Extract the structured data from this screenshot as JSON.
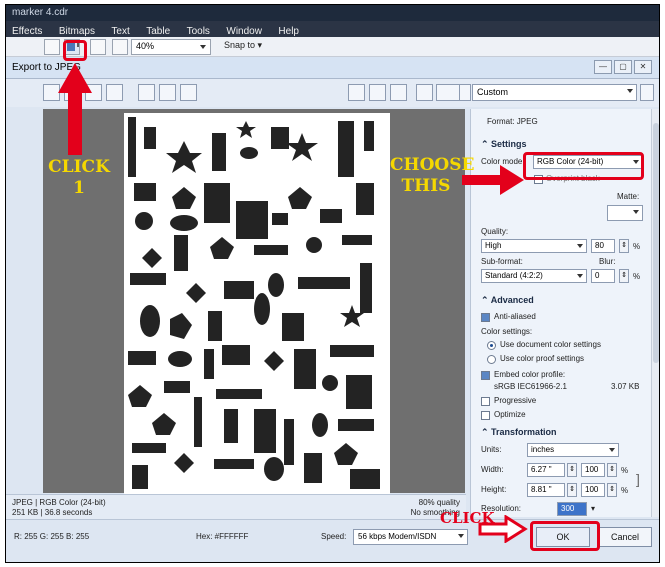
{
  "app": {
    "file_title": "marker 4.cdr",
    "menu": [
      "Effects",
      "Bitmaps",
      "Text",
      "Table",
      "Tools",
      "Window",
      "Help"
    ],
    "zoom": "40%",
    "snap_label": "Snap to"
  },
  "dialog": {
    "title": "Export to JPEG",
    "preset": "Custom",
    "format_label": "Format:",
    "format_value": "JPEG",
    "settings_header": "Settings",
    "color_mode_label": "Color mode:",
    "color_mode_value": "RGB Color (24-bit)",
    "overprint_black": "Overprint black",
    "matte_label": "Matte:",
    "quality_label": "Quality:",
    "quality_value": "High",
    "quality_number": "80",
    "percent": "%",
    "subformat_label": "Sub-format:",
    "subformat_value": "Standard (4:2:2)",
    "blur_label": "Blur:",
    "blur_value": "0",
    "advanced_header": "Advanced",
    "anti_aliased": "Anti-aliased",
    "color_settings_label": "Color settings:",
    "use_document_color": "Use document color settings",
    "use_proof_color": "Use color proof settings",
    "embed_profile": "Embed color profile:",
    "profile_name": "sRGB IEC61966-2.1",
    "profile_size": "3.07 KB",
    "progressive": "Progressive",
    "optimize": "Optimize",
    "transformation_header": "Transformation",
    "units_label": "Units:",
    "units_value": "inches",
    "width_label": "Width:",
    "width_value": "6.27 \"",
    "width_pct": "100",
    "height_label": "Height:",
    "height_value": "8.81 \"",
    "height_pct": "100",
    "resolution_label": "Resolution:",
    "resolution_value": "300",
    "ok": "OK",
    "cancel": "Cancel",
    "status_line1": "JPEG | RGB Color (24-bit)",
    "status_line2": "251 KB | 36.8 seconds",
    "status_right1": "80% quality",
    "status_right2": "No smoothing",
    "rgb_readout": "R: 255 G: 255 B: 255",
    "hex_readout": "Hex: #FFFFFF",
    "speed_label": "Speed:",
    "speed_value": "56 kbps Modem/ISDN"
  },
  "annotations": {
    "click1": "CLICK 1",
    "choose_this": "CHOOSE THIS",
    "click": "CLICK"
  },
  "colors": {
    "annotation_yellow": "#f5d800",
    "annotation_red": "#e3001b",
    "preview_gray": "#6f6f6f",
    "shape_fill": "#232323"
  }
}
